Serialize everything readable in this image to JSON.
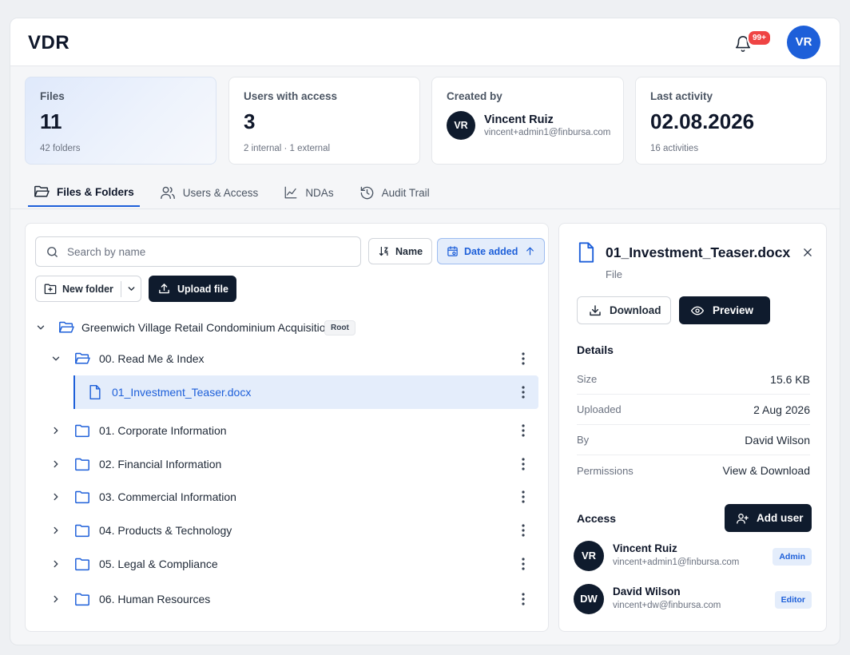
{
  "app": {
    "title": "VDR"
  },
  "header": {
    "notification_badge": "99+",
    "user_initials": "VR"
  },
  "stats": {
    "files": {
      "label": "Files",
      "value": "11",
      "sub": "42 folders"
    },
    "users": {
      "label": "Users with access",
      "value": "3",
      "sub": "2 internal · 1 external"
    },
    "created_by": {
      "label": "Created by",
      "initials": "VR",
      "name": "Vincent Ruiz",
      "email": "vincent+admin1@finbursa.com"
    },
    "last_activity": {
      "label": "Last activity",
      "value": "02.08.2026",
      "sub": "16 activities"
    }
  },
  "tabs": [
    {
      "label": "Files & Folders",
      "icon": "folder-open-icon",
      "active": true
    },
    {
      "label": "Users & Access",
      "icon": "users-icon",
      "active": false
    },
    {
      "label": "NDAs",
      "icon": "chart-line-icon",
      "active": false
    },
    {
      "label": "Audit Trail",
      "icon": "history-icon",
      "active": false
    }
  ],
  "toolbar": {
    "search_placeholder": "Search by name",
    "sort_name": "Name",
    "sort_date": "Date added",
    "new_folder": "New folder",
    "upload_file": "Upload file"
  },
  "tree": {
    "root": {
      "name": "Greenwich Village Retail Condominium Acquisition",
      "badge": "Root"
    },
    "items": [
      {
        "name": "00. Read Me & Index",
        "type": "folder",
        "expanded": true
      },
      {
        "name": "01_Investment_Teaser.docx",
        "type": "file",
        "selected": true
      },
      {
        "name": "01. Corporate Information",
        "type": "folder"
      },
      {
        "name": "02. Financial Information",
        "type": "folder"
      },
      {
        "name": "03. Commercial Information",
        "type": "folder"
      },
      {
        "name": "04. Products & Technology",
        "type": "folder"
      },
      {
        "name": "05. Legal & Compliance",
        "type": "folder"
      },
      {
        "name": "06. Human Resources",
        "type": "folder"
      }
    ]
  },
  "detail": {
    "file_name": "01_Investment_Teaser.docx",
    "file_type": "File",
    "download_label": "Download",
    "preview_label": "Preview",
    "details_title": "Details",
    "rows": [
      {
        "key": "Size",
        "value": "15.6 KB"
      },
      {
        "key": "Uploaded",
        "value": "2 Aug 2026"
      },
      {
        "key": "By",
        "value": "David Wilson"
      },
      {
        "key": "Permissions",
        "value": "View & Download"
      }
    ],
    "access_title": "Access",
    "add_user_label": "Add user",
    "access": [
      {
        "initials": "VR",
        "name": "Vincent Ruiz",
        "email": "vincent+admin1@finbursa.com",
        "role": "Admin"
      },
      {
        "initials": "DW",
        "name": "David Wilson",
        "email": "vincent+dw@finbursa.com",
        "role": "Editor"
      }
    ]
  },
  "colors": {
    "accent": "#1d5fd9",
    "dark": "#0f1b2d",
    "badge_red": "#ef4444"
  }
}
